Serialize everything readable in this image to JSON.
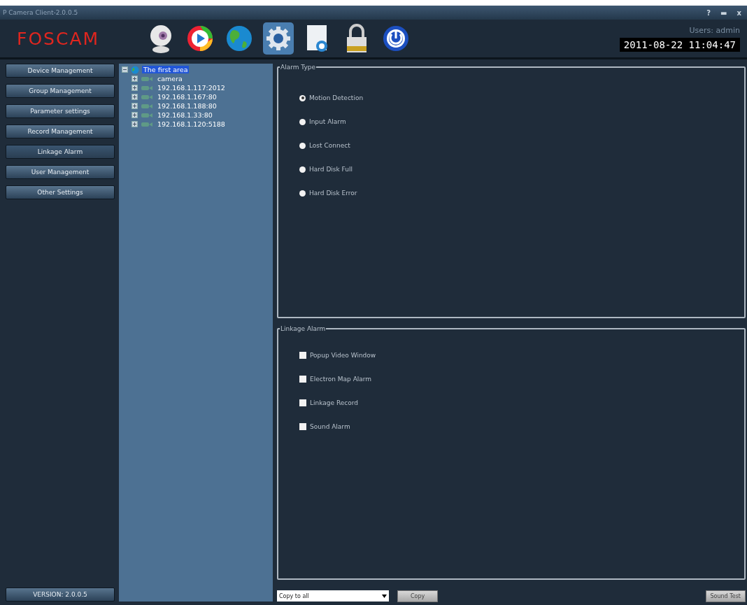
{
  "window": {
    "title": "P Camera Client-2.0.0.5",
    "controls": [
      "?",
      "▬",
      "x"
    ]
  },
  "header": {
    "logo": "FOSCAM",
    "users": "Users: admin",
    "datetime": "2011-08-22 11:04:47"
  },
  "toolbar": [
    {
      "kind": "webcam",
      "selected": false
    },
    {
      "kind": "play",
      "selected": false
    },
    {
      "kind": "globe",
      "selected": false
    },
    {
      "kind": "gear",
      "selected": true
    },
    {
      "kind": "document",
      "selected": false
    },
    {
      "kind": "lock",
      "selected": false
    },
    {
      "kind": "power",
      "selected": false
    }
  ],
  "sidebar": {
    "items": [
      {
        "label": "Device Management",
        "selected": false
      },
      {
        "label": "Group Management",
        "selected": false
      },
      {
        "label": "Parameter settings",
        "selected": false
      },
      {
        "label": "Record Management",
        "selected": false
      },
      {
        "label": "Linkage Alarm",
        "selected": true
      },
      {
        "label": "User Management",
        "selected": false
      },
      {
        "label": "Other Settings",
        "selected": false
      }
    ],
    "version": "VERSION: 2.0.0.5"
  },
  "tree": [
    {
      "label": "The first area",
      "selected": true,
      "expanded": true,
      "children": [
        {
          "label": "camera",
          "expanded": false
        },
        {
          "label": "192.168.1.117:2012",
          "expanded": false
        },
        {
          "label": "192.168.1.167:80",
          "expanded": false
        },
        {
          "label": "192.168.1.188:80",
          "expanded": false
        },
        {
          "label": "192.168.1.33:80",
          "expanded": false
        },
        {
          "label": "192.168.1.120:5188",
          "expanded": false
        }
      ]
    }
  ],
  "alarm_type": {
    "title": "Alarm Type",
    "options": [
      {
        "label": "Motion Detection",
        "selected": true
      },
      {
        "label": "Input Alarm",
        "selected": false
      },
      {
        "label": "Lost Connect",
        "selected": false
      },
      {
        "label": "Hard Disk Full",
        "selected": false
      },
      {
        "label": "Hard Disk Error",
        "selected": false
      }
    ]
  },
  "linkage_alarm": {
    "title": "Linkage Alarm",
    "options": [
      {
        "label": "Popup Video Window",
        "checked": false
      },
      {
        "label": "Electron Map Alarm",
        "checked": false
      },
      {
        "label": "Linkage Record",
        "checked": false
      },
      {
        "label": "Sound Alarm",
        "checked": false
      }
    ]
  },
  "footer": {
    "copy_select": "Copy to all",
    "copy_button": "Copy",
    "sound_test_button": "Sound Test"
  }
}
